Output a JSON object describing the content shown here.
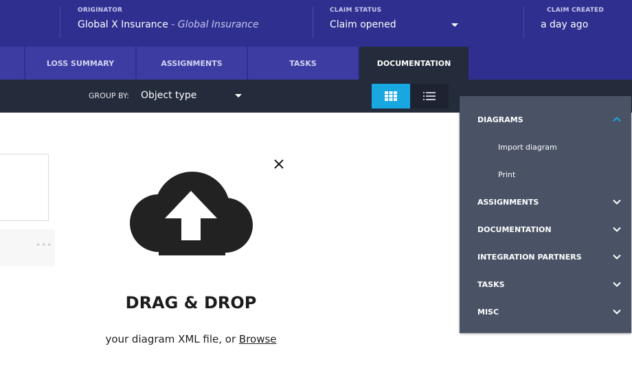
{
  "header": {
    "originator_label": "ORIGINATOR",
    "originator_name": "Global X Insurance",
    "originator_separator": " - ",
    "originator_sub": "Global Insurance",
    "status_label": "CLAIM STATUS",
    "status_value": "Claim opened",
    "created_label": "CLAIM CREATED",
    "created_value": "a day ago"
  },
  "tabs": [
    {
      "label": ""
    },
    {
      "label": "LOSS SUMMARY"
    },
    {
      "label": "ASSIGNMENTS"
    },
    {
      "label": "TASKS"
    },
    {
      "label": "DOCUMENTATION",
      "active": true
    }
  ],
  "toolbar": {
    "group_by_label": "GROUP BY:",
    "group_by_value": "Object type",
    "view_grid_icon": "grid-icon",
    "view_list_icon": "list-icon",
    "accent_color": "#19a7e2"
  },
  "upload": {
    "title": "DRAG & DROP",
    "subtitle": "your diagram XML file, or ",
    "browse_label": "Browse",
    "icon": "cloud-upload-icon",
    "close_icon": "close-icon"
  },
  "menu": {
    "sections": [
      {
        "label": "DIAGRAMS",
        "expanded": true,
        "items": [
          "Import diagram",
          "Print"
        ]
      },
      {
        "label": "ASSIGNMENTS",
        "expanded": false
      },
      {
        "label": "DOCUMENTATION",
        "expanded": false
      },
      {
        "label": "INTEGRATION PARTNERS",
        "expanded": false
      },
      {
        "label": "TASKS",
        "expanded": false
      },
      {
        "label": "MISC",
        "expanded": false
      }
    ]
  },
  "colors": {
    "header_bg": "#2f2f90",
    "tab_bg": "#3c3ca3",
    "toolbar_bg": "#242b3a",
    "menu_bg": "#4a5366",
    "chevron_up": "#19a7e2"
  }
}
